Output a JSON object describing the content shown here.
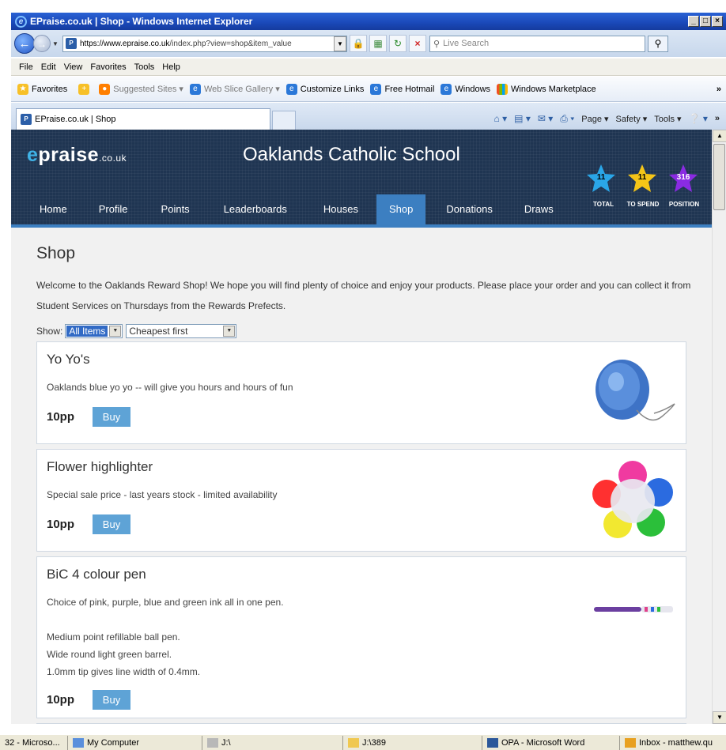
{
  "browser": {
    "title": "EPraise.co.uk | Shop - Windows Internet Explorer",
    "address_host": "https://www.epraise.co.uk",
    "address_path": "/index.php?view=shop&item_value",
    "search_placeholder": "Live Search",
    "menu": [
      "File",
      "Edit",
      "View",
      "Favorites",
      "Tools",
      "Help"
    ],
    "favorites_label": "Favorites",
    "favorites_bar": [
      "Suggested Sites ▾",
      "Web Slice Gallery ▾",
      "Customize Links",
      "Free Hotmail",
      "Windows",
      "Windows Marketplace"
    ],
    "tab_title": "EPraise.co.uk | Shop",
    "commands": [
      "Page ▾",
      "Safety ▾",
      "Tools ▾"
    ]
  },
  "site": {
    "logo_main": "praise",
    "logo_e": "e",
    "logo_suffix": ".co.uk",
    "school": "Oaklands Catholic School",
    "nav": [
      "Home",
      "Profile",
      "Points",
      "Leaderboards",
      "Houses",
      "Shop",
      "Donations",
      "Draws"
    ],
    "active_nav": "Shop",
    "stats": [
      {
        "label": "TOTAL",
        "value": "11",
        "color": "#2aa6e8"
      },
      {
        "label": "TO SPEND",
        "value": "11",
        "color": "#f5c518"
      },
      {
        "label": "POSITION",
        "value": "316",
        "color": "#8a2be2"
      }
    ]
  },
  "shop": {
    "title": "Shop",
    "welcome": "Welcome to the Oaklands Reward Shop!  We hope you will find plenty of choice and enjoy your products.  Please place your order and you can collect it from Student Services on Thursdays from the Rewards Prefects.",
    "show_label": "Show:",
    "filter_value": "All Items",
    "sort_value": "Cheapest first",
    "buy_label": "Buy",
    "products": [
      {
        "name": "Yo Yo's",
        "desc": [
          "Oaklands blue yo yo -- will give you hours and hours of fun"
        ],
        "price": "10pp"
      },
      {
        "name": "Flower highlighter",
        "desc": [
          "Special sale price - last years stock - limited availability"
        ],
        "price": "10pp"
      },
      {
        "name": "BiC 4 colour pen",
        "desc": [
          "Choice of pink, purple, blue and green ink all in one pen.",
          "",
          "Medium point refillable ball pen.",
          "Wide round light green barrel.",
          "1.0mm tip gives line width of 0.4mm."
        ],
        "price": "10pp"
      }
    ]
  },
  "taskbar": [
    "32 - Microso...",
    "My Computer",
    "J:\\",
    "J:\\389",
    "OPA - Microsoft Word",
    "Inbox - matthew.qu"
  ]
}
